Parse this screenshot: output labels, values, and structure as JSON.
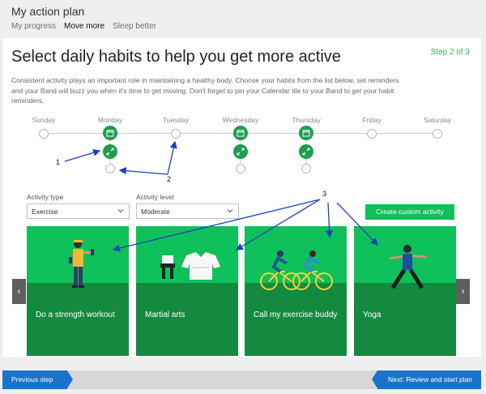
{
  "app": {
    "title": "My action plan"
  },
  "tabs": [
    {
      "label": "My progress"
    },
    {
      "label": "Move more"
    },
    {
      "label": "Sleep better"
    }
  ],
  "main": {
    "heading": "Select daily habits to help you get more active",
    "step": "Step 2 of 3",
    "description": "Consistent activity plays an important role in maintaining a healthy body. Choose your habits from the list below, set reminders and your Band will buzz you when it's time to get moving. Don't forget to pin your Calendar tile to your Band to get your habit reminders."
  },
  "timeline": {
    "days": [
      "Sunday",
      "Monday",
      "Tuesday",
      "Wednesday",
      "Thursday",
      "Friday",
      "Saturday"
    ],
    "scheduled_days": [
      "Monday",
      "Wednesday",
      "Thursday"
    ],
    "icons": [
      "calendar-icon",
      "expand-arrows-icon"
    ]
  },
  "filters": {
    "activity_type_label": "Activity type",
    "activity_type_value": "Exercise",
    "activity_level_label": "Activity level",
    "activity_level_value": "Moderate",
    "create_label": "Create custom activity"
  },
  "tiles": [
    {
      "label": "Do a strength workout",
      "icon": "strength-figure"
    },
    {
      "label": "Martial arts",
      "icon": "martial-arts-gear"
    },
    {
      "label": "Call my exercise buddy",
      "icon": "cyclists"
    },
    {
      "label": "Yoga",
      "icon": "yoga-figure"
    }
  ],
  "carousel": {
    "prev_glyph": "‹",
    "next_glyph": "›"
  },
  "footer": {
    "previous_label": "Previous step",
    "next_label": "Next: Review and start plan"
  },
  "annotations": [
    "1",
    "2",
    "3"
  ],
  "colors": {
    "accent_green": "#0fc15a",
    "dark_green": "#148a3e",
    "icon_green": "#1d9d4f",
    "nav_blue": "#1a73c9",
    "step_green": "#2bb94f",
    "annotation_blue": "#1f3fbf"
  }
}
